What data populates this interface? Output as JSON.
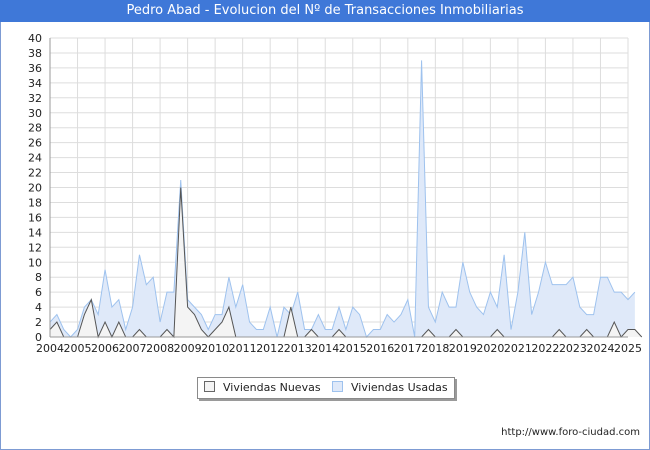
{
  "header": {
    "title": "Pedro Abad - Evolucion del Nº de Transacciones Inmobiliarias"
  },
  "footer": {
    "url": "http://www.foro-ciudad.com"
  },
  "colors": {
    "title_bar": "#3f78d8",
    "nuevas_fill": "#f4f4f4",
    "nuevas_line": "#555555",
    "usadas_fill": "#dfe9f9",
    "usadas_line": "#9ec2ee",
    "grid": "#dddddd"
  },
  "chart_data": {
    "type": "area",
    "title": "Pedro Abad - Evolucion del Nº de Transacciones Inmobiliarias",
    "xlabel": "",
    "ylabel": "",
    "ylim": [
      0,
      40
    ],
    "yticks": [
      0,
      2,
      4,
      6,
      8,
      10,
      12,
      14,
      16,
      18,
      20,
      22,
      24,
      26,
      28,
      30,
      32,
      34,
      36,
      38,
      40
    ],
    "xticks": [
      "2004",
      "2005",
      "2006",
      "2007",
      "2008",
      "2009",
      "2010",
      "2011",
      "2012",
      "2013",
      "2014",
      "2015",
      "2016",
      "2017",
      "2018",
      "2019",
      "2020",
      "2021",
      "2022",
      "2023",
      "2024",
      "2025"
    ],
    "x_start": 2004,
    "points_per_year": 4,
    "grid": true,
    "legend_position": "bottom",
    "series": [
      {
        "name": "Viviendas Nuevas",
        "values": [
          1,
          2,
          0,
          0,
          0,
          3,
          5,
          0,
          2,
          0,
          2,
          0,
          0,
          1,
          0,
          0,
          0,
          1,
          0,
          20,
          4,
          3,
          1,
          0,
          1,
          2,
          4,
          0,
          0,
          0,
          0,
          0,
          0,
          0,
          0,
          4,
          0,
          0,
          1,
          0,
          0,
          0,
          1,
          0,
          0,
          0,
          0,
          0,
          0,
          0,
          0,
          0,
          0,
          0,
          0,
          1,
          0,
          0,
          0,
          1,
          0,
          0,
          0,
          0,
          0,
          1,
          0,
          0,
          0,
          0,
          0,
          0,
          0,
          0,
          1,
          0,
          0,
          0,
          1,
          0,
          0,
          0,
          2,
          0,
          1,
          1,
          0
        ]
      },
      {
        "name": "Viviendas Usadas",
        "values": [
          2,
          3,
          1,
          0,
          1,
          4,
          5,
          3,
          9,
          4,
          5,
          1,
          4,
          11,
          7,
          8,
          2,
          6,
          6,
          21,
          5,
          4,
          3,
          1,
          3,
          3,
          8,
          4,
          7,
          2,
          1,
          1,
          4,
          0,
          4,
          3,
          6,
          1,
          1,
          3,
          1,
          1,
          4,
          1,
          4,
          3,
          0,
          1,
          1,
          3,
          2,
          3,
          5,
          0,
          37,
          4,
          2,
          6,
          4,
          4,
          10,
          6,
          4,
          3,
          6,
          4,
          11,
          1,
          6,
          14,
          3,
          6,
          10,
          7,
          7,
          7,
          8,
          4,
          3,
          3,
          8,
          8,
          6,
          6,
          5,
          6
        ]
      }
    ]
  }
}
